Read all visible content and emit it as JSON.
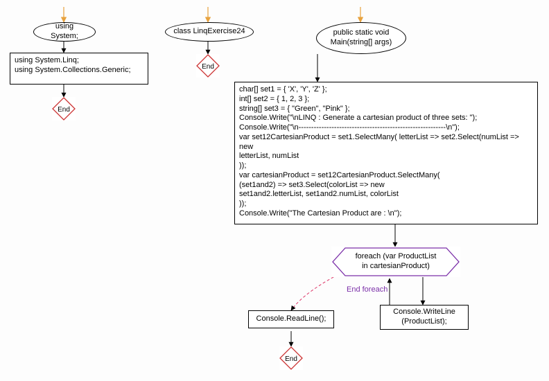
{
  "col1": {
    "start": "using System;",
    "box": "using System.Linq;\nusing System.Collections.Generic;",
    "end": "End"
  },
  "col2": {
    "start": "class LinqExercise24",
    "end": "End"
  },
  "col3": {
    "start": "public static void\nMain(string[] args)",
    "code": "char[] set1 = { 'X', 'Y', 'Z' };\nint[] set2 = { 1, 2, 3 };\nstring[] set3 = { \"Green\", \"Pink\" };\nConsole.Write(\"\\nLINQ : Generate a cartesian product of three sets: \");\nConsole.Write(\"\\n----------------------------------------------------------\\n\");\nvar set12CartesianProduct = set1.SelectMany( letterList => set2.Select(numList => new\nletterList, numList\n));\nvar cartesianProduct = set12CartesianProduct.SelectMany(\n(set1and2) => set3.Select(colorList => new\nset1and2.letterList, set1and2.numList, colorList\n));\nConsole.Write(\"The Cartesian Product are : \\n\");",
    "loop": "foreach (var ProductList\nin cartesianProduct)",
    "loop_end": "End foreach",
    "loop_body": "Console.WriteLine\n(ProductList);",
    "after_loop": "Console.ReadLine();",
    "end": "End"
  }
}
